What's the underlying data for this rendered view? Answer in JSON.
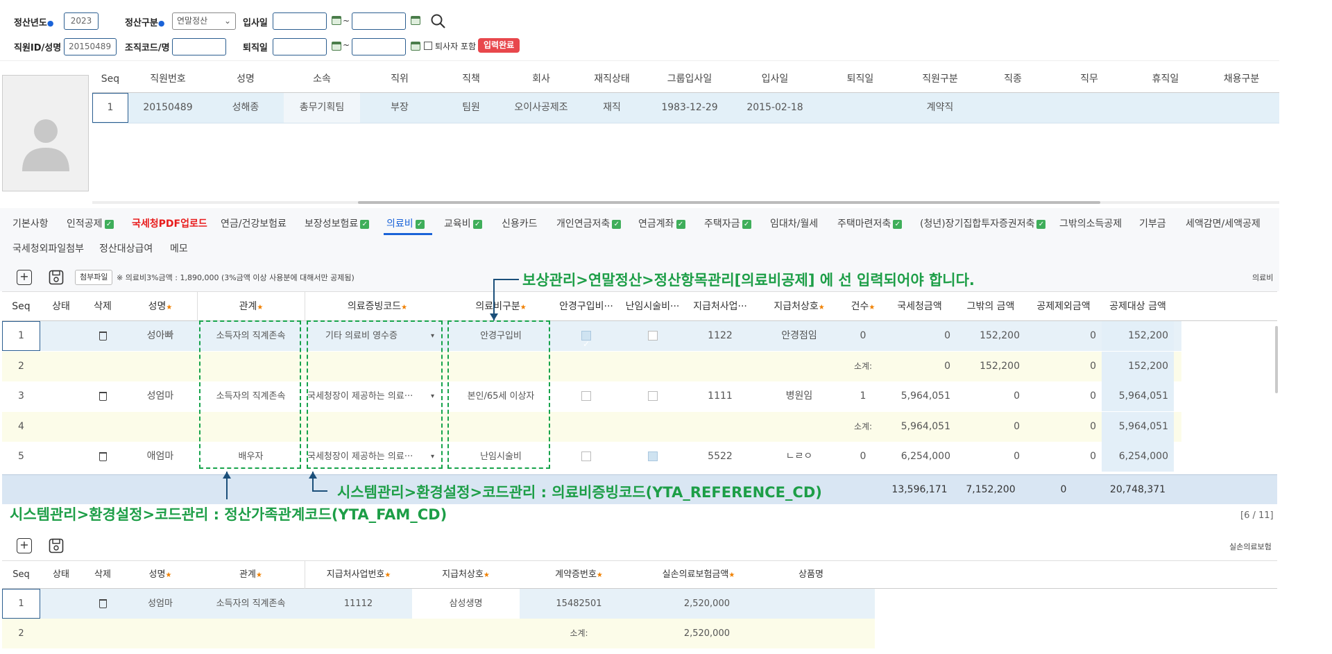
{
  "search": {
    "year_label": "정산년도",
    "year_value": "2023",
    "type_label": "정산구분",
    "type_value": "연말정산",
    "hire_label": "입사일",
    "emp_label": "직원ID/성명",
    "emp_value": "20150489",
    "org_label": "조직코드/명",
    "retire_label": "퇴직일",
    "include_retired_label": "퇴사자 포함",
    "done_badge": "입력완료",
    "tilde": "~"
  },
  "emp_table": {
    "headers": [
      "Seq",
      "직원번호",
      "성명",
      "소속",
      "직위",
      "직책",
      "회사",
      "재직상태",
      "그룹입사일",
      "입사일",
      "퇴직일",
      "직원구분",
      "직종",
      "직무",
      "휴직일",
      "채용구분"
    ],
    "row": [
      "1",
      "20150489",
      "성해종",
      "총무기획팀",
      "부장",
      "팀원",
      "오이사공제조",
      "재직",
      "1983-12-29",
      "2015-02-18",
      "",
      "계약직",
      "",
      "",
      "",
      ""
    ]
  },
  "tabs": {
    "row1": [
      {
        "label": "기본사항",
        "check": false
      },
      {
        "label": "인적공제",
        "check": true
      },
      {
        "label": "국세청PDF업로드",
        "check": false,
        "red": true
      },
      {
        "label": "연금/건강보험료",
        "check": false
      },
      {
        "label": "보장성보험료",
        "check": true
      },
      {
        "label": "의료비",
        "check": true,
        "active": true
      },
      {
        "label": "교육비",
        "check": true
      },
      {
        "label": "신용카드",
        "check": false
      },
      {
        "label": "개인연금저축",
        "check": true
      },
      {
        "label": "연금계좌",
        "check": true
      },
      {
        "label": "주택자금",
        "check": true
      },
      {
        "label": "임대차/월세",
        "check": false
      },
      {
        "label": "주택마련저축",
        "check": true
      },
      {
        "label": "(청년)장기집합투자증권저축",
        "check": true
      },
      {
        "label": "그밖의소득공제",
        "check": false
      },
      {
        "label": "기부금",
        "check": false
      },
      {
        "label": "세액감면/세액공제",
        "check": false
      }
    ],
    "row2": [
      "국세청외파일첨부",
      "정산대상급여",
      "메모"
    ]
  },
  "medical": {
    "attach_label": "첨부파일",
    "info_text": "※ 의료비3%금액 : 1,890,000 (3%금액 이상 사용분에 대해서만 공제됨)",
    "section_title": "의료비",
    "headers": [
      "Seq",
      "상태",
      "삭제",
      "성명",
      "관계",
      "의료증빙코드",
      "의료비구분",
      "안경구입비···",
      "난임시술비···",
      "지급처사업···",
      "지급처상호",
      "건수",
      "국세청금액",
      "그밖의 금액",
      "공제제외금액",
      "공제대상 금액"
    ],
    "rows": [
      {
        "seq": "1",
        "name": "성아빠",
        "rel": "소득자의 직계존속",
        "code": "기타 의료비 영수증",
        "kind": "안경구입비",
        "glasses": true,
        "ivf": false,
        "biz": "1122",
        "shop": "안경점임",
        "cnt": "0",
        "nts": "0",
        "other": "152,200",
        "excl": "0",
        "target": "152,200",
        "trash": true
      },
      {
        "seq": "2",
        "subtotal": "소계:",
        "nts": "0",
        "other": "152,200",
        "excl": "0",
        "target": "152,200"
      },
      {
        "seq": "3",
        "name": "성엄마",
        "rel": "소득자의 직계존속",
        "code": "국세청장이 제공하는 의료···",
        "kind": "본인/65세 이상자",
        "glasses": false,
        "ivf": false,
        "biz": "1111",
        "shop": "병원임",
        "cnt": "1",
        "nts": "5,964,051",
        "other": "0",
        "excl": "0",
        "target": "5,964,051",
        "trash": true
      },
      {
        "seq": "4",
        "subtotal": "소계:",
        "nts": "5,964,051",
        "other": "0",
        "excl": "0",
        "target": "5,964,051"
      },
      {
        "seq": "5",
        "name": "애엄마",
        "rel": "배우자",
        "code": "국세청장이 제공하는 의료···",
        "kind": "난임시술비",
        "glasses": false,
        "ivf": true,
        "biz": "5522",
        "shop": "ㄴㄹㅇ",
        "cnt": "0",
        "nts": "6,254,000",
        "other": "0",
        "excl": "0",
        "target": "6,254,000",
        "trash": true
      }
    ],
    "total": {
      "nts": "13,596,171",
      "other": "7,152,200",
      "excl": "0",
      "target": "20,748,371"
    },
    "paging": "[6 / 11]"
  },
  "annotations": {
    "top": "보상관리>연말정산>정산항목관리[의료비공제] 에 선 입력되어야 합니다.",
    "mid": "시스템관리>환경설정>코드관리 : 의료비증빙코드(YTA_REFERENCE_CD)",
    "bottom": "시스템관리>환경설정>코드관리 : 정산가족관계코드(YTA_FAM_CD)",
    "color": "#1d9e47"
  },
  "insurance": {
    "section_title": "실손의료보험",
    "headers": [
      "Seq",
      "상태",
      "삭제",
      "성명",
      "관계",
      "지급처사업번호",
      "지급처상호",
      "계약증번호",
      "실손의료보험금액",
      "상품명"
    ],
    "rows": [
      {
        "seq": "1",
        "name": "성엄마",
        "rel": "소득자의 직계존속",
        "biz": "11112",
        "shop": "삼성생명",
        "contract": "15482501",
        "amount": "2,520,000",
        "product": ""
      },
      {
        "seq": "2",
        "subtotal": "소계:",
        "amount": "2,520,000"
      }
    ]
  }
}
